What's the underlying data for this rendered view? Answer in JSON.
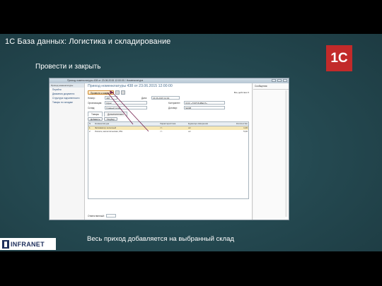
{
  "slide": {
    "title": "1С База данных: Логистика и складирование",
    "subtitle": "Провести и закрыть",
    "caption": "Весь приход добавляется на выбранный склад",
    "logo_text": "1С",
    "logo_color": "#c22a2a",
    "footer_logo_text": "INFRANET"
  },
  "app": {
    "window_title": "Приход номенклатуры 438 от 23.06.2015 12:00:00 / Номенклатура",
    "nav": {
      "header": "Приход номенклатуры",
      "items": [
        "Перейти",
        "Движения документа",
        "Структура подчиненности",
        "Товары по складам"
      ]
    },
    "form": {
      "title": "Приход номенклатуры 438 от 23.06.2015 12:00:00",
      "toolbar": {
        "post_close": "Провести и закрыть",
        "more": "Все действия ▾"
      },
      "fields": [
        {
          "label": "Номер:",
          "value": "438"
        },
        {
          "label": "Организация:",
          "value": "Офис"
        },
        {
          "label": "Склад:",
          "value": "Главный склад"
        }
      ],
      "right_fields": [
        {
          "label": "Дата:",
          "value": "23.06.2015 12:00"
        },
        {
          "label": "Контрагент:",
          "value": "ООО «ТОРГИНВЕСТ»"
        },
        {
          "label": "Договор:",
          "value": "№098"
        }
      ],
      "tabs": [
        "Товары",
        "Дополнительно"
      ],
      "grid_toolbar": [
        "Добавить",
        "Подбор"
      ],
      "grid_headers": [
        "N",
        "Номенклатура",
        "Характеристика",
        "Единица измерения",
        "Количество"
      ],
      "grid_rows": [
        [
          "1",
          "Экскаватор колесный",
          "<>",
          "шт",
          "1,00"
        ],
        [
          "2",
          "Лопата, металлическая, 95х",
          "<>",
          "шт",
          "5,00"
        ]
      ],
      "footer": {
        "comment_label": "Ответственный:"
      }
    },
    "side": {
      "header": "Сообщения:"
    }
  }
}
